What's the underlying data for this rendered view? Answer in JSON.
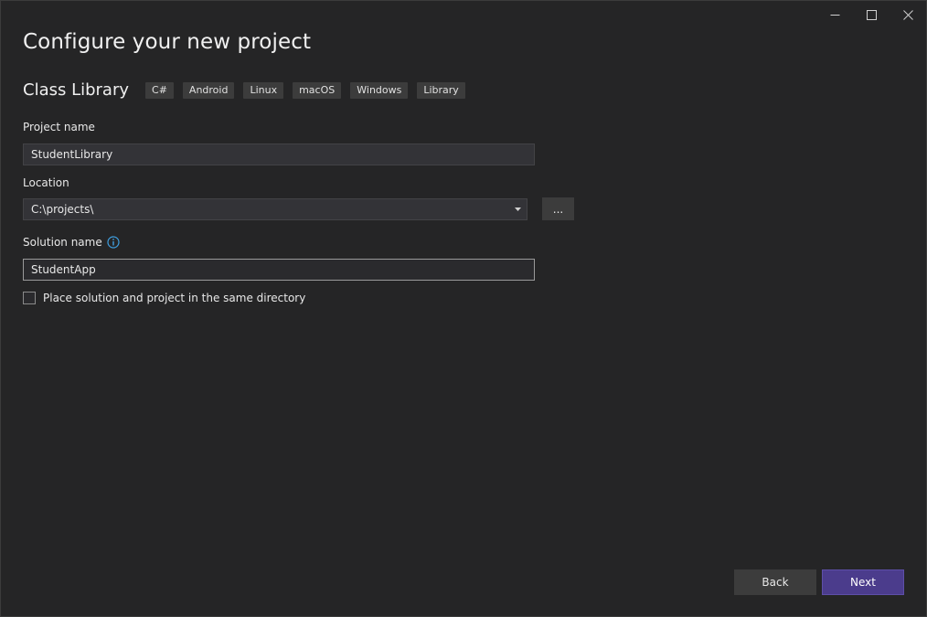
{
  "window": {
    "controls": {
      "minimize_icon": "minimize-icon",
      "maximize_icon": "maximize-icon",
      "close_icon": "close-icon"
    }
  },
  "header": {
    "title": "Configure your new project"
  },
  "template": {
    "name": "Class Library",
    "tags": [
      "C#",
      "Android",
      "Linux",
      "macOS",
      "Windows",
      "Library"
    ]
  },
  "form": {
    "project_name": {
      "label": "Project name",
      "value": "StudentLibrary"
    },
    "location": {
      "label": "Location",
      "value": "C:\\projects\\",
      "browse_label": "..."
    },
    "solution_name": {
      "label": "Solution name",
      "value": "StudentApp",
      "info_icon": "info-icon"
    },
    "same_directory": {
      "label": "Place solution and project in the same directory",
      "checked": false
    }
  },
  "footer": {
    "back_label": "Back",
    "next_label": "Next"
  },
  "colors": {
    "background": "#252526",
    "accent": "#4b3c8c",
    "info": "#3f9fe0"
  }
}
